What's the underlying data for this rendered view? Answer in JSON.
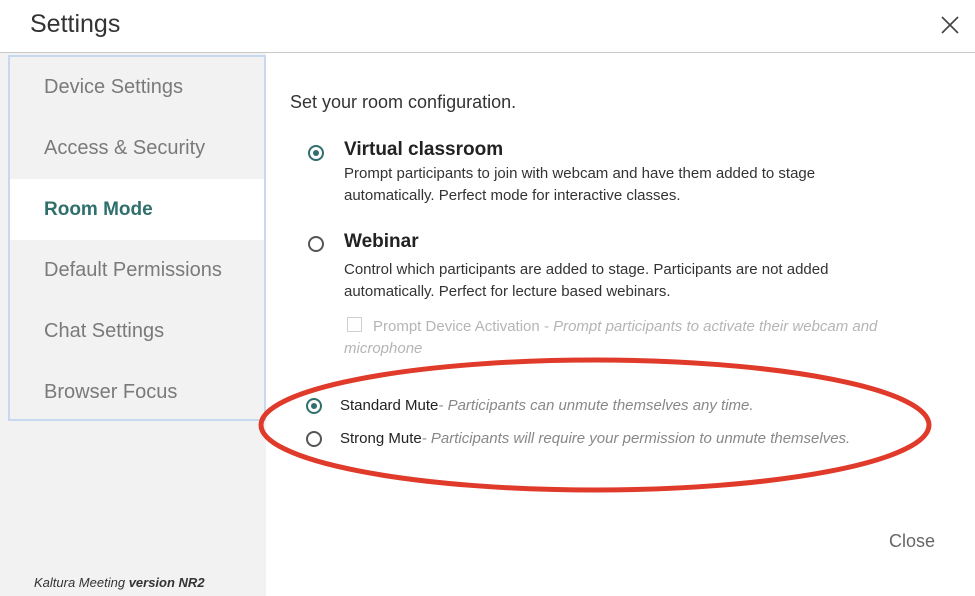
{
  "header": {
    "title": "Settings"
  },
  "sidebar": {
    "items": [
      {
        "label": "Device Settings"
      },
      {
        "label": "Access & Security"
      },
      {
        "label": "Room Mode"
      },
      {
        "label": "Default Permissions"
      },
      {
        "label": "Chat Settings"
      },
      {
        "label": "Browser Focus"
      }
    ],
    "active_index": 2,
    "footer": {
      "app_name": "Kaltura Meeting",
      "version": "version NR2"
    }
  },
  "main": {
    "intro": "Set your room configuration.",
    "options": [
      {
        "title": "Virtual classroom",
        "checked": true,
        "description": "Prompt participants to join with webcam and have them added to stage automatically. Perfect mode for interactive classes."
      },
      {
        "title": "Webinar",
        "checked": false,
        "description": "Control which participants are added to stage. Participants are not added automatically. Perfect for lecture based webinars."
      }
    ],
    "prompt_device": {
      "label": "Prompt Device Activation",
      "description": " - Prompt participants to activate their webcam and microphone",
      "checked": false
    },
    "mute_options": [
      {
        "label": "Standard Mute",
        "description": "- Participants can unmute themselves any time.",
        "checked": true
      },
      {
        "label": "Strong Mute",
        "description": "- Participants will require your permission to unmute themselves.",
        "checked": false
      }
    ],
    "close_label": "Close"
  },
  "colors": {
    "accent": "#2f6f6c",
    "annotation": "#e03a2a",
    "sidebar_bg": "#f2f2f2"
  },
  "icons": {
    "close": "close-icon"
  }
}
